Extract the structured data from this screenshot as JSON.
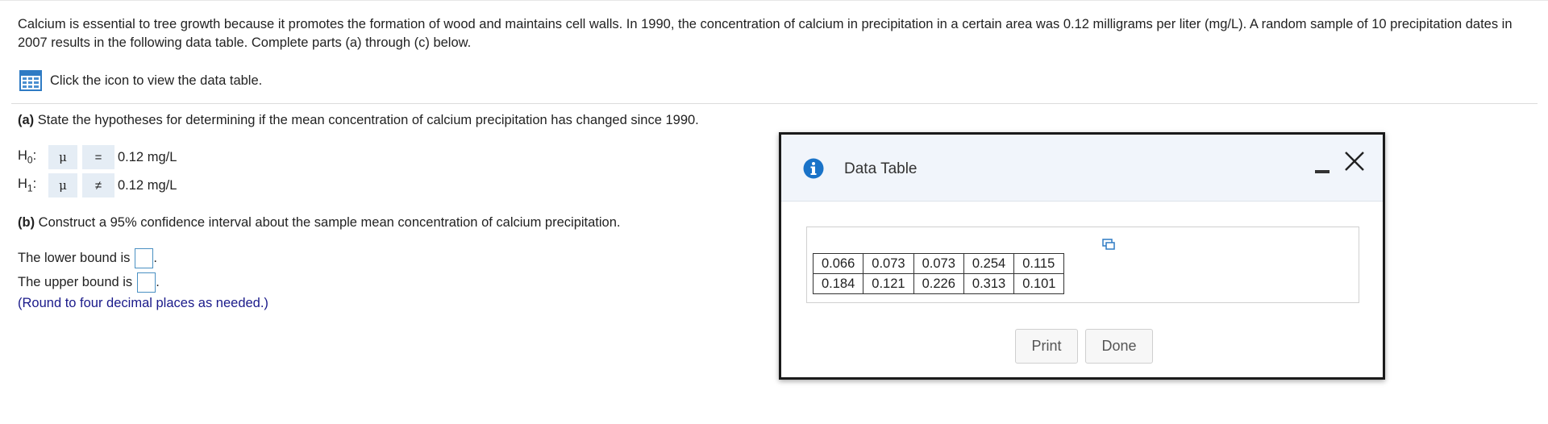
{
  "intro": {
    "text": "Calcium is essential to tree growth because it promotes the formation of wood and maintains cell walls. In 1990, the concentration of calcium in precipitation in a certain area was 0.12 milligrams per liter (mg/L). A random sample of 10 precipitation dates in 2007 results in the following data table. Complete parts (a) through (c) below."
  },
  "data_link": {
    "label": "Click the icon to view the data table.",
    "icon": "table-grid-icon"
  },
  "part_a": {
    "label": "(a)",
    "text": " State the hypotheses for determining if the mean concentration of calcium precipitation has changed since 1990.",
    "h0": {
      "label": "H",
      "sub": "0",
      "colon": ":",
      "param": "μ",
      "op": "=",
      "value": "0.12 mg/L"
    },
    "h1": {
      "label": "H",
      "sub": "1",
      "colon": ":",
      "param": "μ",
      "op": "≠",
      "value": "0.12 mg/L"
    }
  },
  "part_b": {
    "label": "(b)",
    "text": " Construct a 95% confidence interval about the sample mean concentration of calcium precipitation.",
    "lower_label": "The lower bound is",
    "lower_value": "",
    "upper_label": "The upper bound is",
    "upper_value": "",
    "period": ".",
    "note": "(Round to four decimal places as needed.)"
  },
  "dialog": {
    "title": "Data Table",
    "rows": [
      [
        "0.066",
        "0.073",
        "0.073",
        "0.254",
        "0.115"
      ],
      [
        "0.184",
        "0.121",
        "0.226",
        "0.313",
        "0.101"
      ]
    ],
    "print_label": "Print",
    "done_label": "Done"
  },
  "colors": {
    "accent": "#1a73c8",
    "note": "#1a1a8a",
    "dropdown_bg": "#e5edf5",
    "header_bg": "#f1f5fb"
  }
}
